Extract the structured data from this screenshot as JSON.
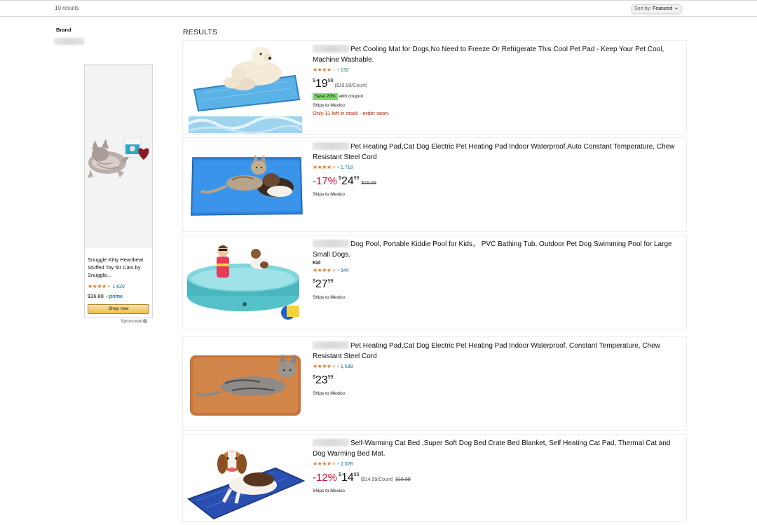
{
  "header": {
    "result_count": "10 results",
    "sort_label": "Sort by:",
    "sort_value": "Featured"
  },
  "filters": {
    "brand_title": "Brand"
  },
  "ad": {
    "title": "Snuggle Kitty Heartbeat Stuffed Toy for Cats by Snuggle...",
    "rating": 4.5,
    "review_count": "1,620",
    "price": "$36.88",
    "prime_label": "prime",
    "button_label": "Shop now",
    "sponsored_label": "Sponsored"
  },
  "results_heading": "RESULTS",
  "products": [
    {
      "title": "Pet Cooling Mat for Dogs,No Need to Freeze Or Refrigerate This Cool Pet Pad - Keep Your Pet Cool, Machine Washable.",
      "rating": 4.0,
      "review_count": "132",
      "discount": "",
      "price_symbol": "$",
      "price_whole": "19",
      "price_fraction": "99",
      "unit_price": "($19.99/Count)",
      "list_price": "",
      "coupon": "Save 20%",
      "coupon_note": "with coupon",
      "shipping": "Ships to Mexico",
      "stock": "Only 11 left in stock - order soon."
    },
    {
      "title": "Pet Heating Pad,Cat Dog Electric Pet Heating Pad Indoor Waterproof,Auto Constant Temperature, Chew Resistant Steel Cord",
      "rating": 4.5,
      "review_count": "1,718",
      "discount": "-17%",
      "price_symbol": "$",
      "price_whole": "24",
      "price_fraction": "99",
      "unit_price": "",
      "list_price": "$29.99",
      "coupon": "",
      "coupon_note": "",
      "shipping": "Ships to Mexico",
      "stock": ""
    },
    {
      "title": "Dog Pool, Portable Kiddie Pool for Kids，  PVC Bathing Tub, Outdoor Pet Dog Swimming Pool for Large Small Dogs.",
      "brand": "Kid",
      "rating": 4.5,
      "review_count": "544",
      "discount": "",
      "price_symbol": "$",
      "price_whole": "27",
      "price_fraction": "99",
      "unit_price": "",
      "list_price": "",
      "coupon": "",
      "coupon_note": "",
      "shipping": "Ships to Mexico",
      "stock": ""
    },
    {
      "title": "Pet Heating Pad,Cat Dog Electric Pet Heating Pad Indoor Waterproof, Constant Temperature, Chew Resistant Steel Cord",
      "rating": 4.5,
      "review_count": "1,599",
      "discount": "",
      "price_symbol": "$",
      "price_whole": "23",
      "price_fraction": "99",
      "unit_price": "",
      "list_price": "",
      "coupon": "",
      "coupon_note": "",
      "shipping": "Ships to Mexico",
      "stock": ""
    },
    {
      "title": "Self-Warming Cat Bed ,Super Soft Dog Bed Crate Bed Blanket, Self Heating Cat Pad, Thermal Cat and Dog Warming Bed Mat.",
      "rating": 4.5,
      "review_count": "2,028",
      "discount": "-12%",
      "price_symbol": "$",
      "price_whole": "14",
      "price_fraction": "99",
      "unit_price": "($14.99/Count)",
      "list_price": "$16.99",
      "coupon": "",
      "coupon_note": "",
      "shipping": "Ships to Mexico",
      "stock": ""
    }
  ],
  "colors": {
    "star": "#de7921",
    "discount": "#cc0c39",
    "coupon_bg": "#7fda69",
    "link": "#007185",
    "stock_warning": "#b12704",
    "shop_button": "#f0c14b"
  }
}
